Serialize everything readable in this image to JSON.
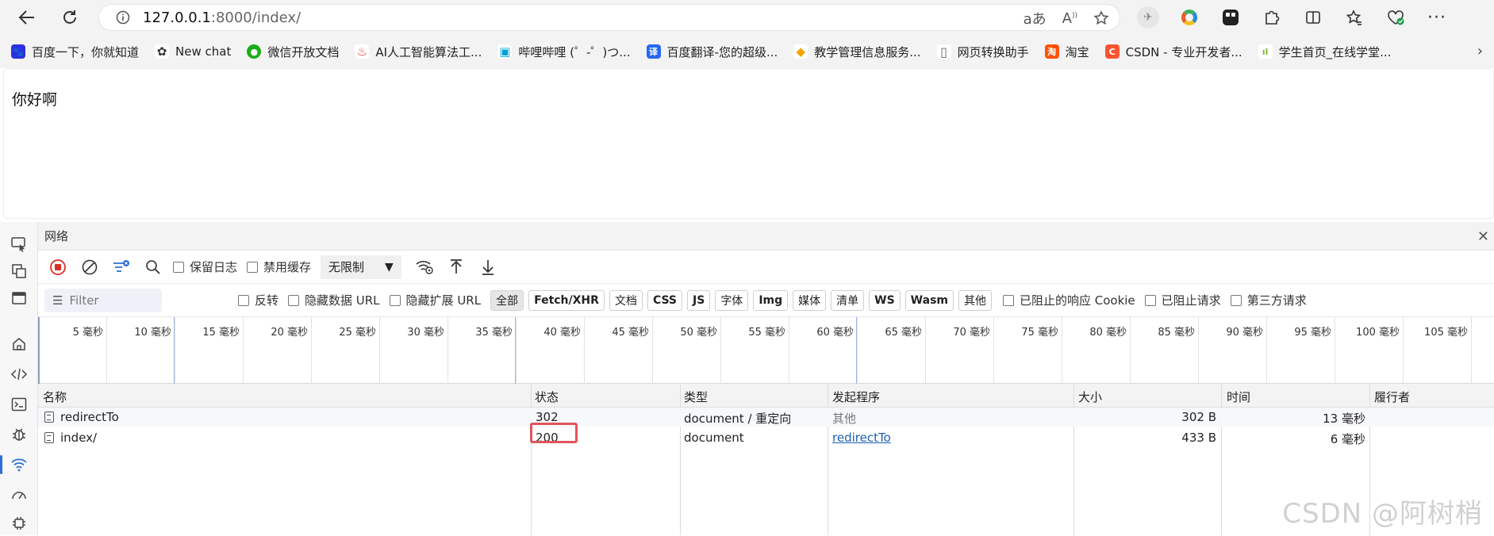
{
  "browser": {
    "url_host": "127.0.0.1",
    "url_rest": ":8000/index/",
    "addr_icons": [
      "read-aloud-icon",
      "translate-icon",
      "favorite-star-icon"
    ],
    "tools": [
      "extension-bird-icon",
      "extension-ring-icon",
      "extension-app-icon",
      "extensions-puzzle-icon",
      "split-screen-icon",
      "favorites-icon",
      "browser-health-icon",
      "more-icon"
    ]
  },
  "bookmarks": [
    {
      "label": "百度一下，你就知道",
      "color": "#2932e1",
      "glyph": "🐾"
    },
    {
      "label": "New chat",
      "color": "#555555",
      "glyph": "✿"
    },
    {
      "label": "微信开放文档",
      "color": "#1aad19",
      "glyph": "●"
    },
    {
      "label": "AI人工智能算法工...",
      "color": "#e3342f",
      "glyph": "♨"
    },
    {
      "label": "哔哩哔哩 (゜-゜)つ...",
      "color": "#00a1d6",
      "glyph": "▣"
    },
    {
      "label": "百度翻译-您的超级...",
      "color": "#2468f2",
      "glyph": "译"
    },
    {
      "label": "教学管理信息服务...",
      "color": "#f4a300",
      "glyph": "◆"
    },
    {
      "label": "网页转换助手",
      "color": "#888888",
      "glyph": "▯"
    },
    {
      "label": "淘宝",
      "color": "#ff5000",
      "glyph": "淘"
    },
    {
      "label": "CSDN - 专业开发者...",
      "color": "#fc5531",
      "glyph": "C"
    },
    {
      "label": "学生首页_在线学堂...",
      "color": "#7fb539",
      "glyph": "ıl"
    }
  ],
  "page": {
    "text": "你好啊"
  },
  "devtools": {
    "panel_title": "网络",
    "toolbar": {
      "preserve_log": "保留日志",
      "disable_cache": "禁用缓存",
      "throttle": "无限制"
    },
    "filter": {
      "placeholder": "Filter",
      "invert": "反转",
      "hide_data_url": "隐藏数据 URL",
      "hide_ext_url": "隐藏扩展 URL",
      "types": [
        "全部",
        "Fetch/XHR",
        "文档",
        "CSS",
        "JS",
        "字体",
        "Img",
        "媒体",
        "清单",
        "WS",
        "Wasm",
        "其他"
      ],
      "blocked_cookies": "已阻止的响应 Cookie",
      "blocked_requests": "已阻止请求",
      "third_party": "第三方请求"
    },
    "timeline_ticks": [
      "5 毫秒",
      "10 毫秒",
      "15 毫秒",
      "20 毫秒",
      "25 毫秒",
      "30 毫秒",
      "35 毫秒",
      "40 毫秒",
      "45 毫秒",
      "50 毫秒",
      "55 毫秒",
      "60 毫秒",
      "65 毫秒",
      "70 毫秒",
      "75 毫秒",
      "80 毫秒",
      "85 毫秒",
      "90 毫秒",
      "95 毫秒",
      "100 毫秒",
      "105 毫秒"
    ],
    "columns": [
      "名称",
      "状态",
      "类型",
      "发起程序",
      "大小",
      "时间",
      "履行者"
    ],
    "rows": [
      {
        "name": "redirectTo",
        "status": "302",
        "type": "document / 重定向",
        "initiator": "其他",
        "size": "302 B",
        "time": "13 毫秒"
      },
      {
        "name": "index/",
        "status": "200",
        "type": "document",
        "initiator": "redirectTo",
        "size": "433 B",
        "time": "6 毫秒"
      }
    ]
  },
  "watermark": "CSDN @阿树梢"
}
